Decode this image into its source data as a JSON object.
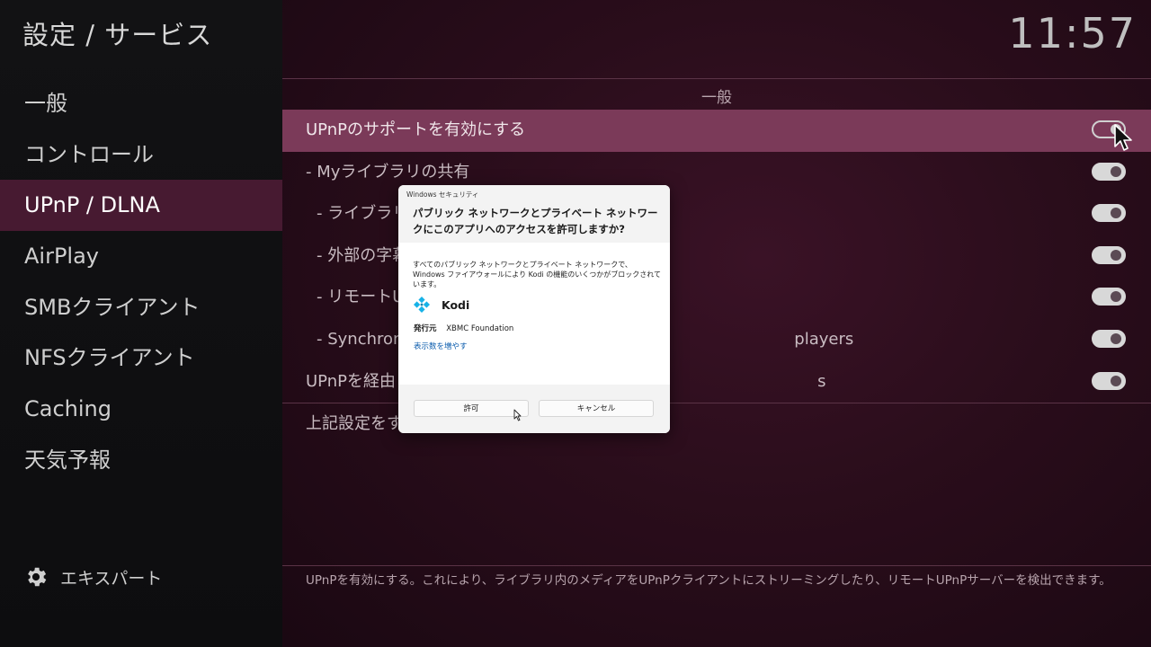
{
  "header": {
    "breadcrumb": "設定 / サービス",
    "clock": "11:57"
  },
  "sidebar": {
    "items": [
      {
        "label": "一般",
        "selected": false
      },
      {
        "label": "コントロール",
        "selected": false
      },
      {
        "label": "UPnP / DLNA",
        "selected": true
      },
      {
        "label": "AirPlay",
        "selected": false
      },
      {
        "label": "SMBクライアント",
        "selected": false
      },
      {
        "label": "NFSクライアント",
        "selected": false
      },
      {
        "label": "Caching",
        "selected": false
      },
      {
        "label": "天気予報",
        "selected": false
      }
    ],
    "expert_label": "エキスパート",
    "expert_icon": "gear-icon"
  },
  "main": {
    "section_title": "一般",
    "rows": [
      {
        "label": "UPnPのサポートを有効にする",
        "toggle": "off",
        "selected": true
      },
      {
        "label": "- Myライブラリの共有",
        "toggle": "on",
        "selected": false
      },
      {
        "label": "- ライブラリ",
        "toggle": "on",
        "selected": false
      },
      {
        "label": "- 外部の字幕",
        "toggle": "on",
        "selected": false
      },
      {
        "label": "- リモートU",
        "toggle": "on",
        "selected": false
      },
      {
        "label": "- Synchron                                                                            players",
        "toggle": "on",
        "selected": false
      },
      {
        "label": "UPnPを経由                                                                                  s",
        "toggle": "on",
        "selected": false
      }
    ],
    "note": "上記設定をす",
    "description": "UPnPを有効にする。これにより、ライブラリ内のメディアをUPnPクライアントにストリーミングしたり、リモートUPnPサーバーを検出できます。"
  },
  "dialog": {
    "caption": "Windows セキュリティ",
    "heading": "パブリック ネットワークとプライベート ネットワークにこのアプリへのアクセスを許可しますか?",
    "body": "すべてのパブリック ネットワークとプライベート ネットワークで、Windows ファイアウォールにより Kodi の機能のいくつかがブロックされています。",
    "app_name": "Kodi",
    "app_icon": "kodi-logo-icon",
    "publisher_key": "発行元",
    "publisher_value": "XBMC Foundation",
    "more_link": "表示数を増やす",
    "allow_label": "許可",
    "cancel_label": "キャンセル"
  },
  "colors": {
    "accent": "#7b3a59",
    "sidebar_selected": "#471a31",
    "link": "#0b5cad",
    "kodi_blue": "#17b2e7"
  }
}
